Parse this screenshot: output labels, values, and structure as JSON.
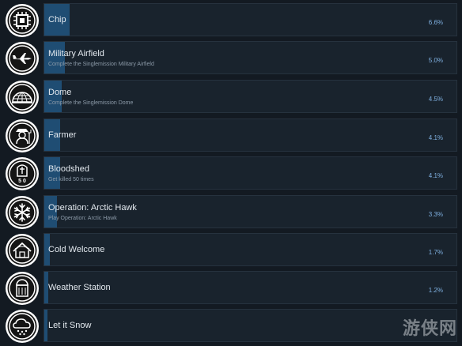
{
  "achievements": [
    {
      "title": "Chip",
      "description": "",
      "percent": "6.6%",
      "icon": "chip-icon"
    },
    {
      "title": "Military Airfield",
      "description": "Complete the Singlemission Military Airfield",
      "percent": "5.0%",
      "icon": "jet-icon"
    },
    {
      "title": "Dome",
      "description": "Complete the Singlemission Dome",
      "percent": "4.5%",
      "icon": "dome-icon"
    },
    {
      "title": "Farmer",
      "description": "",
      "percent": "4.1%",
      "icon": "farmer-icon"
    },
    {
      "title": "Bloodshed",
      "description": "Get killed 50 times",
      "percent": "4.1%",
      "icon": "gravestone-50-icon"
    },
    {
      "title": "Operation: Arctic Hawk",
      "description": "Play Operation: Arctic Hawk",
      "percent": "3.3%",
      "icon": "snowflake-icon"
    },
    {
      "title": "Cold Welcome",
      "description": "",
      "percent": "1.7%",
      "icon": "snowy-house-icon"
    },
    {
      "title": "Weather Station",
      "description": "",
      "percent": "1.2%",
      "icon": "weather-station-icon"
    },
    {
      "title": "Let it Snow",
      "description": "",
      "percent": "",
      "icon": "snow-cloud-icon"
    }
  ],
  "progress_fractions": [
    0.066,
    0.05,
    0.045,
    0.041,
    0.041,
    0.033,
    0.017,
    0.012,
    0.008
  ],
  "watermark": "游侠网",
  "colors": {
    "background": "#131a22",
    "bar": "#19232d",
    "fill": "#1f4d73",
    "percent": "#7fb0e0"
  }
}
